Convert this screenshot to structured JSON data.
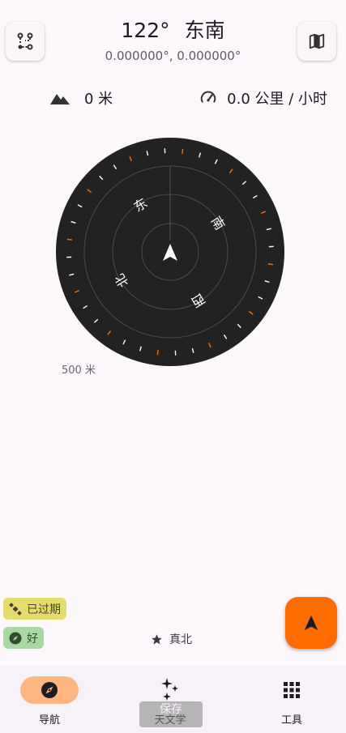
{
  "header": {
    "bearing": "122°",
    "direction": "东南",
    "coordinates": "0.000000°,  0.000000°"
  },
  "stats": {
    "altitude": "0 米",
    "speed": "0.0 公里 / 小时"
  },
  "compass": {
    "labels": {
      "east": "东",
      "south": "南",
      "west": "西",
      "north": "北"
    },
    "scale": "500 米"
  },
  "status": {
    "gps": "已过期",
    "accuracy": "好",
    "reference": "真北"
  },
  "nav": {
    "items": [
      {
        "label": "导航",
        "icon": "compass-icon",
        "active": true
      },
      {
        "label": "天文学",
        "icon": "sparkles-icon",
        "active": false
      },
      {
        "label": "工具",
        "icon": "grid-icon",
        "active": false
      }
    ]
  },
  "toast": "保存",
  "colors": {
    "accent": "#ff6d00",
    "active_nav": "#ffb680",
    "gps_chip": "#e4dc6e",
    "accuracy_chip": "#a9d9a3",
    "dial": "#222222"
  }
}
